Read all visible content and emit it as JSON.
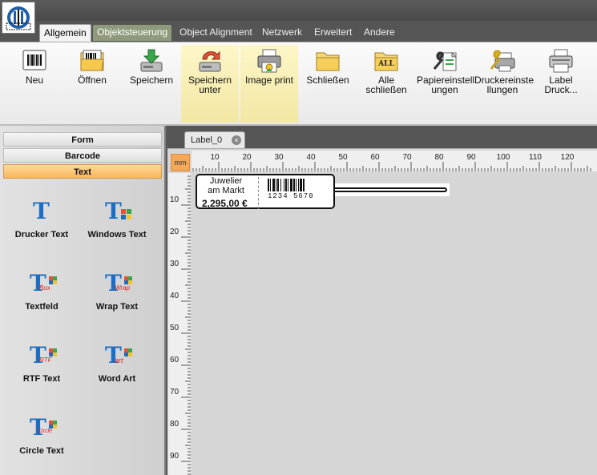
{
  "menu_tabs": [
    {
      "label": "Allgemein",
      "state": "active"
    },
    {
      "label": "Objektsteuerung",
      "state": "context"
    },
    {
      "label": "Object Alignment",
      "state": "normal"
    },
    {
      "label": "Netzwerk",
      "state": "normal"
    },
    {
      "label": "Erweitert",
      "state": "normal"
    },
    {
      "label": "Andere",
      "state": "normal"
    }
  ],
  "ribbon": {
    "new": {
      "label": "Neu",
      "icon": "barcode-page-icon"
    },
    "open": {
      "label": "Öffnen",
      "icon": "open-folder-icon"
    },
    "save": {
      "label": "Speichern",
      "icon": "save-drive-icon"
    },
    "save_as": {
      "line1": "Speichern",
      "line2": "unter",
      "icon": "save-as-icon"
    },
    "image_print": {
      "label": "Image print",
      "icon": "image-printer-icon"
    },
    "close": {
      "label": "Schließen",
      "icon": "folder-icon"
    },
    "close_all": {
      "label": "Alle schließen",
      "icon": "folder-all-icon",
      "badge": "ALL"
    },
    "paper_settings": {
      "line1": "Papiereinstell",
      "line2": "ungen",
      "icon": "paper-wrench-icon"
    },
    "printer_settings": {
      "line1": "Druckereinste",
      "line2": "llungen",
      "icon": "printer-wrench-icon"
    },
    "label_print": {
      "label": "Label Druck...",
      "icon": "label-printer-icon"
    }
  },
  "sidebar": {
    "categories": [
      {
        "label": "Form",
        "selected": false
      },
      {
        "label": "Barcode",
        "selected": false
      },
      {
        "label": "Text",
        "selected": true
      }
    ],
    "tools": [
      {
        "label": "Drucker Text",
        "icon": "printer-text-icon"
      },
      {
        "label": "Windows Text",
        "icon": "windows-text-icon"
      },
      {
        "label": "Textfeld",
        "icon": "textbox-icon",
        "sub": "Box"
      },
      {
        "label": "Wrap Text",
        "icon": "wrap-text-icon",
        "sub": "Wrap"
      },
      {
        "label": "RTF Text",
        "icon": "rtf-text-icon",
        "sub": "RTF"
      },
      {
        "label": "Word Art",
        "icon": "word-art-icon",
        "sub": "art"
      },
      {
        "label": "Circle Text",
        "icon": "circle-text-icon",
        "sub": "Circle"
      }
    ]
  },
  "document": {
    "tab_label": "Label_0",
    "close_glyph": "×",
    "unit": "mm",
    "h_ticks": [
      "10",
      "20",
      "30",
      "40",
      "50",
      "60",
      "70",
      "80",
      "90",
      "100",
      "110",
      "120"
    ],
    "v_ticks": [
      "10",
      "20",
      "30",
      "40",
      "50",
      "60",
      "70",
      "80",
      "90"
    ],
    "label": {
      "line1": "Juwelier",
      "line2": "am Markt",
      "price": "2,295,00 €",
      "barcode_digits": "1234 5670"
    }
  },
  "colors": {
    "accent_orange": "#f7b75b",
    "highlight_yellow": "#f3e7a3",
    "context_tab": "#8e9a7b"
  }
}
